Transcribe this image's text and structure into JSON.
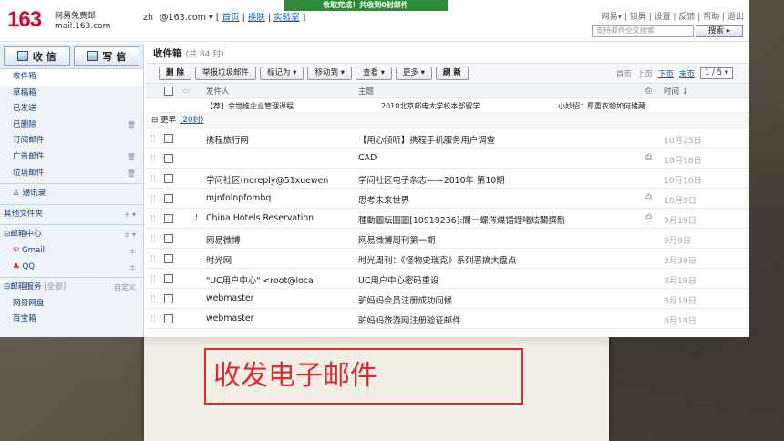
{
  "notice": "收取完成！共收到0封邮件",
  "header": {
    "logo_num": "163",
    "logo_line1": "网易免费邮",
    "logo_line2": "mail.163.com",
    "account_name": "zh",
    "account_email": "@163.com",
    "account_links": [
      "首页",
      "换肤",
      "实验室"
    ],
    "top_links": [
      "网易",
      "锁屏",
      "设置",
      "反馈",
      "帮助",
      "退出"
    ],
    "search_placeholder": "支持邮件全文搜索",
    "search_button": "搜索"
  },
  "sidebar": {
    "receive_label": "收 信",
    "compose_label": "写 信",
    "folders": [
      {
        "label": "收件箱"
      },
      {
        "label": "草稿箱"
      },
      {
        "label": "已发送"
      },
      {
        "label": "已删除"
      },
      {
        "label": "订阅邮件"
      },
      {
        "label": "广告邮件"
      },
      {
        "label": "垃圾邮件"
      }
    ],
    "contacts": "通讯录",
    "other_folders": "其他文件夹",
    "mail_center": "邮箱中心",
    "gmail": "Gmail",
    "qq": "QQ",
    "services": "邮箱服务",
    "services_all": "[全部]",
    "services_custom": "自定义",
    "netdisk": "网易网盘",
    "treasure": "百宝箱"
  },
  "main": {
    "title": "收件箱",
    "count": "(共 84 封)",
    "toolbar": [
      "删 除",
      "举报垃圾邮件",
      "标记为 ▾",
      "移动到 ▾",
      "查看 ▾",
      "更多 ▾",
      "刷 新"
    ],
    "pager": {
      "first": "首页",
      "prev": "上页",
      "next": "下页",
      "last": "末页",
      "page": "1 / 5"
    },
    "columns": {
      "sender": "发件人",
      "subject": "主题",
      "time": "时间"
    },
    "ad": {
      "left": "【荐】余世维企业管理课程",
      "mid": "2010北京邮电大学校本部留学",
      "right": "小妙招：厚重衣物如何储藏"
    },
    "group": {
      "label": "更早",
      "count": "(20封)"
    },
    "rows": [
      {
        "sender": "携程旅行网",
        "subject": "【用心倾听】携程手机服务用户调查",
        "att": "",
        "time": "10月25日",
        "flag": ""
      },
      {
        "sender": "",
        "subject": "CAD",
        "att": "⎙",
        "time": "10月18日",
        "flag": ""
      },
      {
        "sender": "学问社区(noreply@51xuewen",
        "subject": "学问社区电子杂志——2010年 第10期",
        "att": "",
        "time": "10月10日",
        "flag": ""
      },
      {
        "sender": "mjnfolnpfombq",
        "subject": "思考未来世界",
        "att": "⎙",
        "time": "10月8日",
        "flag": ""
      },
      {
        "sender": "China Hotels Reservation",
        "subject": "種動圖紜圖圖[10919236]:閬ー螺涔煤镭鋰啫炫闈撰鬝",
        "att": "⎙",
        "time": "9月19日",
        "flag": "!"
      },
      {
        "sender": "网易微博",
        "subject": "网易微博周刊第一期",
        "att": "",
        "time": "9月9日",
        "flag": ""
      },
      {
        "sender": "时光网",
        "subject": "时光周刊：《怪物史瑞克》系列恶搞大盘点",
        "att": "",
        "time": "8月30日",
        "flag": ""
      },
      {
        "sender": "\"UC用户中心\" <root@loca",
        "subject": "UC用户中心密码重设",
        "att": "",
        "time": "8月19日",
        "flag": ""
      },
      {
        "sender": "webmaster",
        "subject": "驴妈妈会员注册成功问候",
        "att": "",
        "time": "8月19日",
        "flag": ""
      },
      {
        "sender": "webmaster",
        "subject": "驴妈妈旅游网注册验证邮件",
        "att": "",
        "time": "8月19日",
        "flag": ""
      }
    ]
  },
  "caption": "收发电子邮件"
}
